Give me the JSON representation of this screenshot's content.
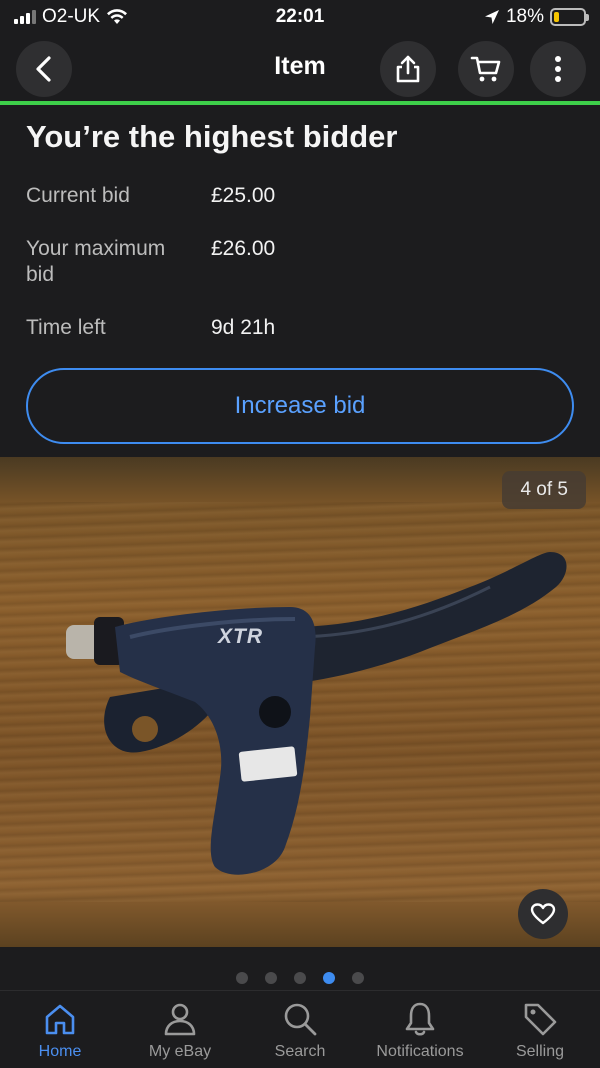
{
  "status_bar": {
    "carrier": "O2-UK",
    "time": "22:01",
    "battery_percent": "18%",
    "battery_level": 0.18,
    "icons": [
      "signal-icon",
      "wifi-icon",
      "location-arrow-icon",
      "battery-icon"
    ]
  },
  "nav": {
    "title": "Item",
    "back_icon": "chevron-left-icon",
    "share_icon": "share-icon",
    "cart_icon": "cart-icon",
    "more_icon": "more-vertical-icon"
  },
  "bid_panel": {
    "title": "You’re the highest bidder",
    "rows": [
      {
        "label": "Current bid",
        "value": "£25.00"
      },
      {
        "label": "Your maximum bid",
        "value": "£26.00"
      },
      {
        "label": "Time left",
        "value": "9d 21h"
      }
    ],
    "increase_label": "Increase bid"
  },
  "gallery": {
    "page_indicator": "4 of 5",
    "current_index": 4,
    "total": 5,
    "brand_text": "XTR",
    "favorite_icon": "heart-icon"
  },
  "tabs": [
    {
      "label": "Home",
      "icon": "home-icon",
      "active": true
    },
    {
      "label": "My eBay",
      "icon": "user-icon",
      "active": false
    },
    {
      "label": "Search",
      "icon": "search-icon",
      "active": false
    },
    {
      "label": "Notifications",
      "icon": "bell-icon",
      "active": false
    },
    {
      "label": "Selling",
      "icon": "tag-icon",
      "active": false
    }
  ],
  "colors": {
    "accent": "#3e8cf0",
    "progress": "#3ecf4a",
    "background": "#1c1c1e"
  }
}
